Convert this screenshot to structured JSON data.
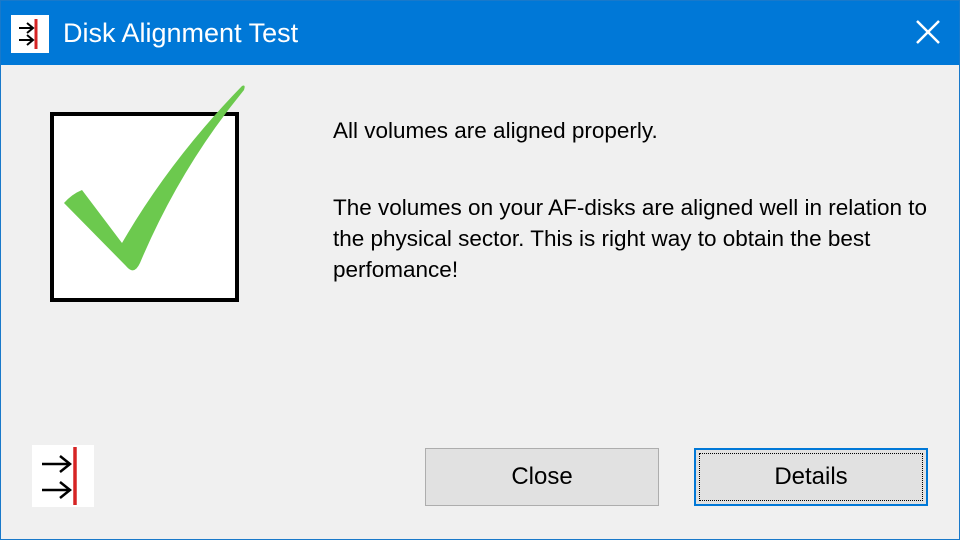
{
  "window": {
    "title": "Disk Alignment Test",
    "app_icon": "alignment-arrows-icon",
    "close_icon": "close-icon"
  },
  "status": {
    "icon": "green-checkmark-icon",
    "headline": "All volumes are aligned properly.",
    "detail": "The volumes on your AF-disks are aligned well in relation to the physical sector. This is right way to obtain the best perfomance!"
  },
  "buttons": {
    "close_label": "Close",
    "details_label": "Details"
  },
  "colors": {
    "titlebar": "#0078d7",
    "check_green": "#6cc94e",
    "focus_border": "#0078d7"
  }
}
